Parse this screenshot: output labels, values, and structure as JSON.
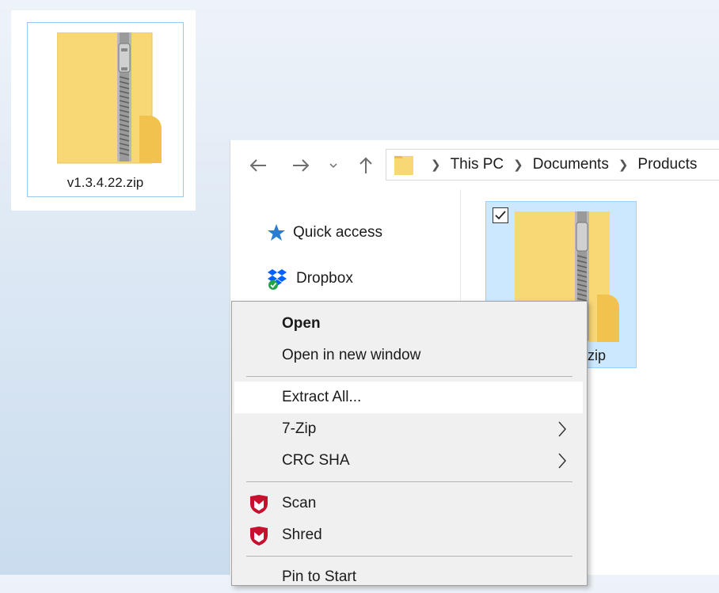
{
  "desktop": {
    "file_label": "v1.3.4.22.zip"
  },
  "explorer": {
    "breadcrumbs": [
      "This PC",
      "Documents",
      "Products"
    ],
    "nav_items": [
      "Quick access",
      "Dropbox"
    ],
    "file_label_visible": "zip"
  },
  "context_menu": {
    "open": "Open",
    "open_new_window": "Open in new window",
    "extract_all": "Extract All...",
    "seven_zip": "7-Zip",
    "crc_sha": "CRC SHA",
    "scan": "Scan",
    "shred": "Shred",
    "pin_to_start": "Pin to Start"
  },
  "colors": {
    "selection": "#cce8ff",
    "folder_yellow": "#f8d775",
    "mcafee_red": "#c8102e"
  }
}
